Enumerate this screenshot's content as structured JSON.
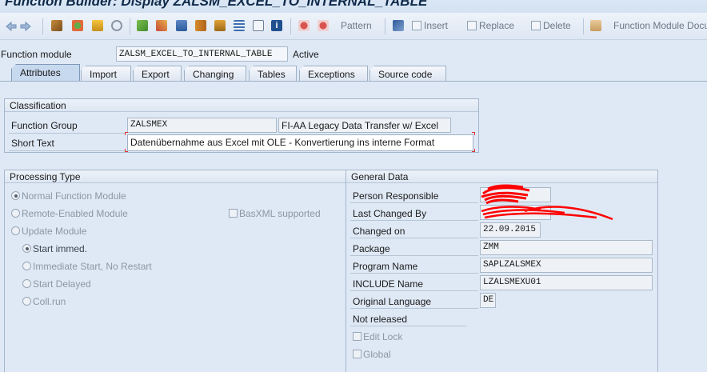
{
  "window": {
    "title": "Function Builder: Display ZALSM_EXCEL_TO_INTERNAL_TABLE"
  },
  "toolbar": {
    "icons": [
      "back-icon",
      "forward-icon",
      "other-object-icon",
      "check-icon",
      "activate-icon",
      "where-used-icon",
      "display-object-list-icon",
      "navigation-window-icon",
      "edit-icon",
      "enhance-icon",
      "hierarchy-icon",
      "display-list-icon",
      "frame-icon",
      "info-icon",
      "debug-icon",
      "test-icon",
      "insert-icon"
    ],
    "pattern_label": "Pattern",
    "insert_label": "Insert",
    "replace_label": "Replace",
    "delete_label": "Delete",
    "fm_doc_label": "Function Module Docu"
  },
  "header": {
    "function_module_label": "Function module",
    "function_module_value": "ZALSM_EXCEL_TO_INTERNAL_TABLE",
    "status": "Active"
  },
  "tabs": [
    "Attributes",
    "Import",
    "Export",
    "Changing",
    "Tables",
    "Exceptions",
    "Source code"
  ],
  "classification": {
    "title": "Classification",
    "function_group_label": "Function Group",
    "function_group_value": "ZALSMEX",
    "function_group_desc": "FI-AA Legacy Data Transfer w/ Excel",
    "short_text_label": "Short Text",
    "short_text_value": "Datenübernahme aus Excel mit OLE - Konvertierung ins interne Format"
  },
  "processing": {
    "title": "Processing Type",
    "normal": "Normal Function Module",
    "remote": "Remote-Enabled Module",
    "basxml": "BasXML supported",
    "update": "Update Module",
    "start_immed": "Start immed.",
    "immediate_no_restart": "Immediate Start, No Restart",
    "start_delayed": "Start Delayed",
    "coll_run": "Coll.run"
  },
  "general": {
    "title": "General Data",
    "person_label": "Person Responsible",
    "person_value": "",
    "last_changed_by_label": "Last Changed By",
    "last_changed_by_value": "",
    "changed_on_label": "Changed on",
    "changed_on_value": "22.09.2015",
    "package_label": "Package",
    "package_value": "ZMM",
    "program_label": "Program Name",
    "program_value": "SAPLZALSMEX",
    "include_label": "INCLUDE Name",
    "include_value": "LZALSMEXU01",
    "language_label": "Original Language",
    "language_value": "DE",
    "release_status": "Not released",
    "edit_lock": "Edit Lock",
    "global": "Global"
  }
}
